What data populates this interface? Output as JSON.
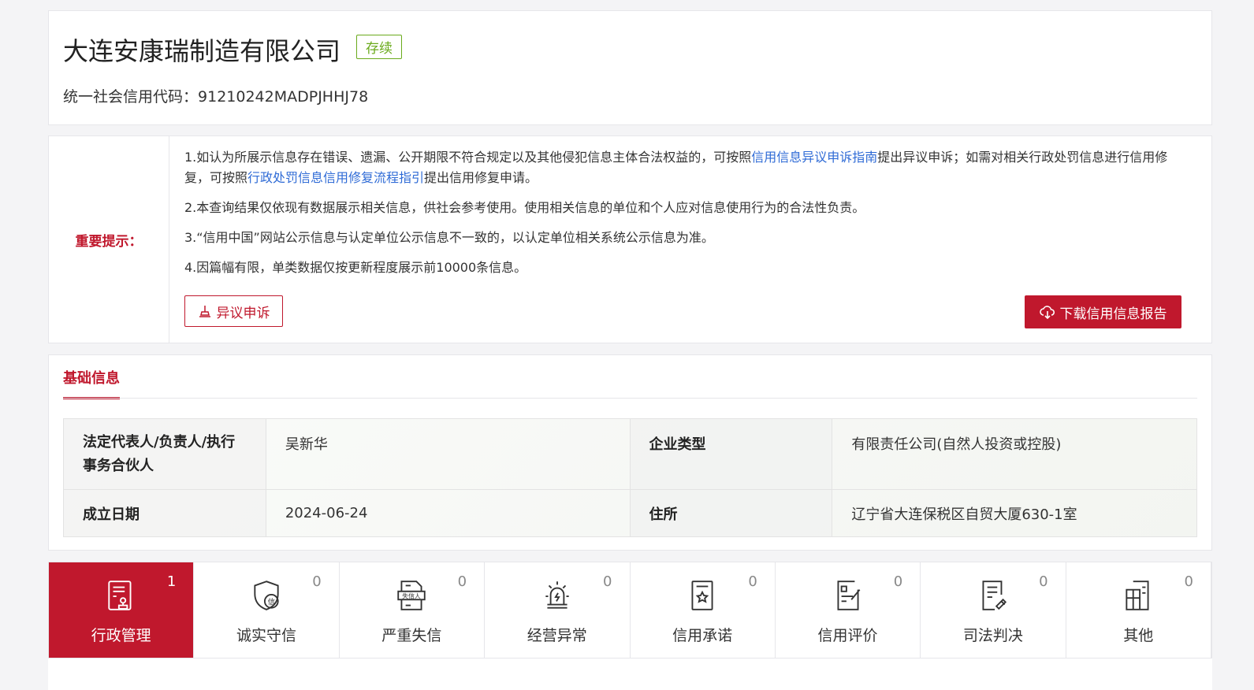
{
  "company": {
    "name": "大连安康瑞制造有限公司",
    "status": "存续",
    "credit_code_label": "统一社会信用代码：",
    "credit_code": "91210242MADPJHHJ78"
  },
  "notice": {
    "label": "重要提示：",
    "tip1_a": "1.如认为所展示信息存在错误、遗漏、公开期限不符合规定以及其他侵犯信息主体合法权益的，可按照",
    "tip1_link1": "信用信息异议申诉指南",
    "tip1_b": "提出异议申诉；如需对相关行政处罚信息进行信用修复，可按照",
    "tip1_link2": "行政处罚信息信用修复流程指引",
    "tip1_c": "提出信用修复申请。",
    "tip2": "2.本查询结果仅依现有数据展示相关信息，供社会参考使用。使用相关信息的单位和个人应对信息使用行为的合法性负责。",
    "tip3": "3.“信用中国”网站公示信息与认定单位公示信息不一致的，以认定单位相关系统公示信息为准。",
    "tip4": "4.因篇幅有限，单类数据仅按更新程度展示前10000条信息。",
    "appeal_button": "异议申诉",
    "download_button": "下载信用信息报告"
  },
  "basic": {
    "tab": "基础信息",
    "rows": [
      [
        {
          "k": "法定代表人/负责人/执行事务合伙人",
          "v": "吴新华"
        },
        {
          "k": "企业类型",
          "v": "有限责任公司(自然人投资或控股)"
        }
      ],
      [
        {
          "k": "成立日期",
          "v": "2024-06-24"
        },
        {
          "k": "住所",
          "v": "辽宁省大连保税区自贸大厦630-1室"
        }
      ]
    ]
  },
  "categories": [
    {
      "label": "行政管理",
      "count": "1",
      "icon": "document-stamp"
    },
    {
      "label": "诚实守信",
      "count": "0",
      "icon": "shield-credit"
    },
    {
      "label": "严重失信",
      "count": "0",
      "icon": "dishonest-person"
    },
    {
      "label": "经营异常",
      "count": "0",
      "icon": "alarm-light"
    },
    {
      "label": "信用承诺",
      "count": "0",
      "icon": "certificate-star"
    },
    {
      "label": "信用评价",
      "count": "0",
      "icon": "evaluation-form"
    },
    {
      "label": "司法判决",
      "count": "0",
      "icon": "judgment-doc"
    },
    {
      "label": "其他",
      "count": "0",
      "icon": "other-doc"
    }
  ],
  "colors": {
    "accent": "#c0182d",
    "status": "#6aaa1c",
    "link": "#2f6bd6"
  }
}
